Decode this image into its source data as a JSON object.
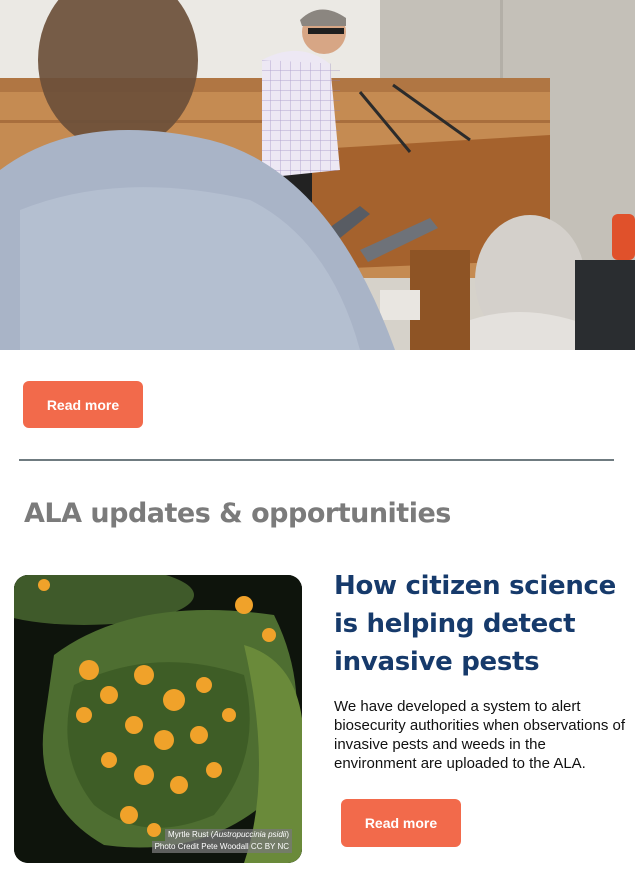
{
  "hero": {
    "image_description": "presenter-at-lectern-photo"
  },
  "top_cta": {
    "label": "Read more"
  },
  "section": {
    "heading": "ALA updates & opportunities"
  },
  "article": {
    "title": "How citizen science is helping detect invasive pests",
    "body": "We have developed a system to alert biosecurity authorities when observations of invasive pests and weeds in the environment are uploaded to the ALA.",
    "cta_label": "Read more",
    "image_caption_line1_prefix": "Myrtle Rust (",
    "image_caption_line1_italic": "Austropuccinia psidii",
    "image_caption_line1_suffix": ")",
    "image_caption_line2": "Photo Credit Pete Woodall CC BY NC"
  },
  "colors": {
    "button": "#f26a4b",
    "title": "#163a6b",
    "heading": "#7b7b7b",
    "divider": "#6f7b80"
  }
}
